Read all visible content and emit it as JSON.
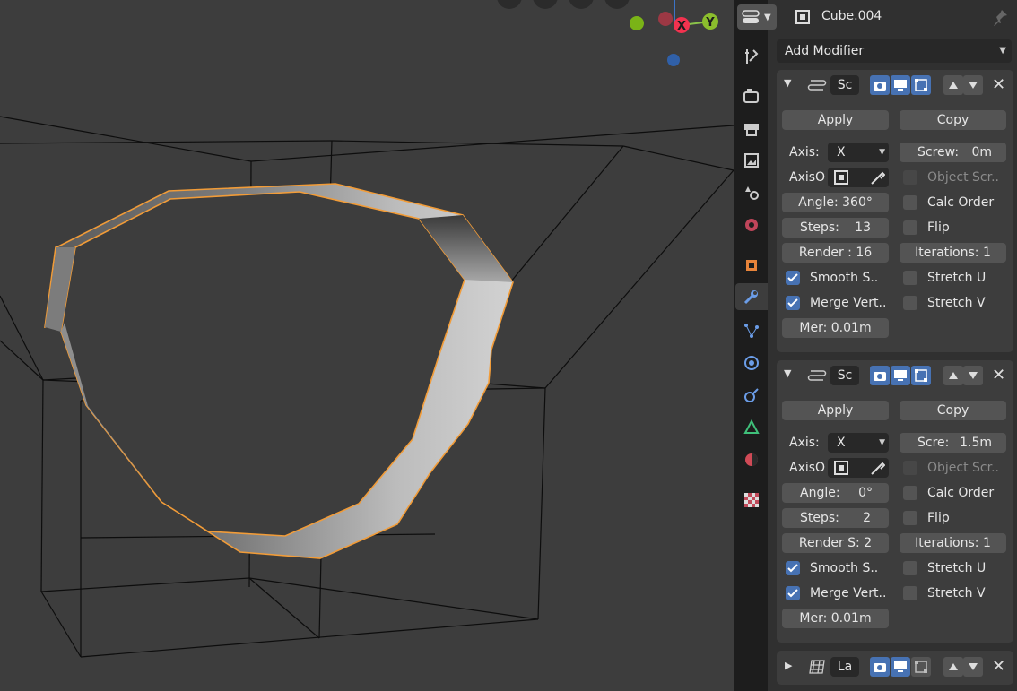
{
  "header": {
    "object_name": "Cube.004",
    "add_modifier": "Add Modifier"
  },
  "gizmo": {
    "x_label": "X",
    "y_label": "Y"
  },
  "modifiers": [
    {
      "name": "Sc",
      "apply": "Apply",
      "copy": "Copy",
      "axis_label": "Axis:",
      "axis_value": "X",
      "screw": "Screw:",
      "screw_value": "0m",
      "axis_object_label": "AxisO",
      "object_screw": "Object Scr..",
      "angle": "Angle: 360°",
      "calc_order": "Calc Order",
      "steps_label": "Steps:",
      "steps_value": "13",
      "flip": "Flip",
      "render": "Render : 16",
      "iterations": "Iterations: 1",
      "smooth": "Smooth S..",
      "stretch_u": "Stretch U",
      "merge": "Merge Vert..",
      "stretch_v": "Stretch V",
      "merge_dist": "Mer: 0.01m"
    },
    {
      "name": "Sc",
      "apply": "Apply",
      "copy": "Copy",
      "axis_label": "Axis:",
      "axis_value": "X",
      "screw": "Scre:",
      "screw_value": "1.5m",
      "axis_object_label": "AxisO",
      "object_screw": "Object Scr..",
      "angle_label": "Angle:",
      "angle_value": "0°",
      "calc_order": "Calc Order",
      "steps_label": "Steps:",
      "steps_value": "2",
      "flip": "Flip",
      "render": "Render S: 2",
      "iterations": "Iterations: 1",
      "smooth": "Smooth S..",
      "stretch_u": "Stretch U",
      "merge": "Merge Vert..",
      "stretch_v": "Stretch V",
      "merge_dist": "Mer: 0.01m"
    },
    {
      "name": "La"
    }
  ],
  "colors": {
    "accent_blue": "#4772b3",
    "selection_orange": "#f29c38",
    "panel_bg": "#3d3d3d"
  }
}
